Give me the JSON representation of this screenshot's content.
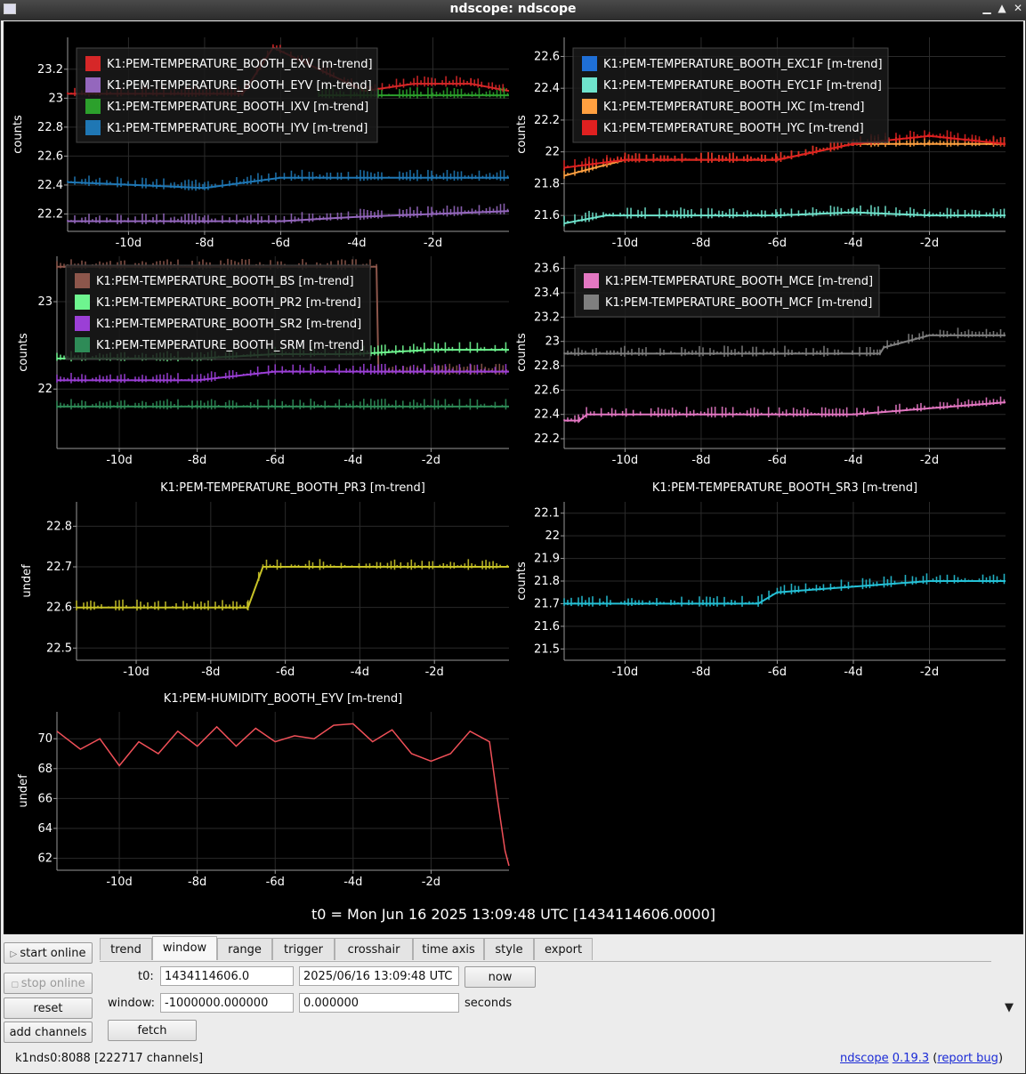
{
  "window": {
    "title": "ndscope: ndscope",
    "minimize": "▁",
    "maximize": "▲",
    "close": "✕"
  },
  "t0_label": "t0 = Mon Jun 16 2025 13:09:48 UTC [1434114606.0000]",
  "plots": [
    {
      "id": "p1",
      "title": "",
      "ylabel": "counts",
      "yticks": [
        "23.2",
        "23",
        "22.8",
        "22.6",
        "22.4",
        "22.2"
      ],
      "xticks": [
        "-10d",
        "-8d",
        "-6d",
        "-4d",
        "-2d"
      ],
      "legend": [
        {
          "name": "K1:PEM-TEMPERATURE_BOOTH_EXV [m-trend]",
          "color": "#d62728"
        },
        {
          "name": "K1:PEM-TEMPERATURE_BOOTH_EYV [m-trend]",
          "color": "#9467bd"
        },
        {
          "name": "K1:PEM-TEMPERATURE_BOOTH_IXV [m-trend]",
          "color": "#2ca02c"
        },
        {
          "name": "K1:PEM-TEMPERATURE_BOOTH_IYV [m-trend]",
          "color": "#1f77b4"
        }
      ]
    },
    {
      "id": "p2",
      "title": "",
      "ylabel": "counts",
      "yticks": [
        "22.6",
        "22.4",
        "22.2",
        "22",
        "21.8",
        "21.6"
      ],
      "xticks": [
        "-10d",
        "-8d",
        "-6d",
        "-4d",
        "-2d"
      ],
      "legend": [
        {
          "name": "K1:PEM-TEMPERATURE_BOOTH_EXC1F [m-trend]",
          "color": "#1f6fd6"
        },
        {
          "name": "K1:PEM-TEMPERATURE_BOOTH_EYC1F [m-trend]",
          "color": "#6fe3cc"
        },
        {
          "name": "K1:PEM-TEMPERATURE_BOOTH_IXC [m-trend]",
          "color": "#ffa040"
        },
        {
          "name": "K1:PEM-TEMPERATURE_BOOTH_IYC [m-trend]",
          "color": "#e02020"
        }
      ]
    },
    {
      "id": "p3",
      "title": "",
      "ylabel": "counts",
      "yticks": [
        "23",
        "22"
      ],
      "xticks": [
        "-10d",
        "-8d",
        "-6d",
        "-4d",
        "-2d"
      ],
      "legend": [
        {
          "name": "K1:PEM-TEMPERATURE_BOOTH_BS [m-trend]",
          "color": "#8c564b"
        },
        {
          "name": "K1:PEM-TEMPERATURE_BOOTH_PR2 [m-trend]",
          "color": "#6ef58f"
        },
        {
          "name": "K1:PEM-TEMPERATURE_BOOTH_SR2 [m-trend]",
          "color": "#9b3fd6"
        },
        {
          "name": "K1:PEM-TEMPERATURE_BOOTH_SRM [m-trend]",
          "color": "#2e8b57"
        }
      ]
    },
    {
      "id": "p4",
      "title": "",
      "ylabel": "counts",
      "yticks": [
        "23.6",
        "23.4",
        "23.2",
        "23",
        "22.8",
        "22.6",
        "22.4",
        "22.2"
      ],
      "xticks": [
        "-10d",
        "-8d",
        "-6d",
        "-4d",
        "-2d"
      ],
      "legend": [
        {
          "name": "K1:PEM-TEMPERATURE_BOOTH_MCE [m-trend]",
          "color": "#e377c2"
        },
        {
          "name": "K1:PEM-TEMPERATURE_BOOTH_MCF [m-trend]",
          "color": "#7f7f7f"
        }
      ]
    },
    {
      "id": "p5",
      "title": "K1:PEM-TEMPERATURE_BOOTH_PR3 [m-trend]",
      "ylabel": "undef",
      "yticks": [
        "22.8",
        "22.7",
        "22.6",
        "22.5"
      ],
      "xticks": [
        "-10d",
        "-8d",
        "-6d",
        "-4d",
        "-2d"
      ],
      "legend": []
    },
    {
      "id": "p6",
      "title": "K1:PEM-TEMPERATURE_BOOTH_SR3 [m-trend]",
      "ylabel": "counts",
      "yticks": [
        "22.1",
        "22",
        "21.9",
        "21.8",
        "21.7",
        "21.6",
        "21.5"
      ],
      "xticks": [
        "-10d",
        "-8d",
        "-6d",
        "-4d",
        "-2d"
      ],
      "legend": []
    },
    {
      "id": "p7",
      "title": "K1:PEM-HUMIDITY_BOOTH_EYV [m-trend]",
      "ylabel": "undef",
      "yticks": [
        "70",
        "68",
        "66",
        "64",
        "62"
      ],
      "xticks": [
        "-10d",
        "-8d",
        "-6d",
        "-4d",
        "-2d"
      ],
      "legend": []
    }
  ],
  "chart_data": [
    {
      "type": "line",
      "xlabel": "",
      "ylabel": "counts",
      "xlim": [
        -11.6,
        0
      ],
      "ylim": [
        22.08,
        23.42
      ],
      "series": [
        {
          "name": "K1:PEM-TEMPERATURE_BOOTH_EXV [m-trend]",
          "color": "#d62728",
          "x": [
            -11.6,
            -7,
            -6.2,
            -3.8,
            -2.5,
            -1,
            0
          ],
          "y": [
            23.03,
            23.03,
            23.35,
            23.05,
            23.1,
            23.1,
            23.05
          ]
        },
        {
          "name": "K1:PEM-TEMPERATURE_BOOTH_EYV [m-trend]",
          "color": "#9467bd",
          "x": [
            -11.6,
            -8,
            -6,
            -4,
            -2,
            0
          ],
          "y": [
            22.15,
            22.15,
            22.15,
            22.18,
            22.2,
            22.22
          ]
        },
        {
          "name": "K1:PEM-TEMPERATURE_BOOTH_IXV [m-trend]",
          "color": "#2ca02c",
          "x": [
            -5,
            -4,
            -2,
            0
          ],
          "y": [
            23.02,
            23.02,
            23.02,
            23.02
          ]
        },
        {
          "name": "K1:PEM-TEMPERATURE_BOOTH_IYV [m-trend]",
          "color": "#1f77b4",
          "x": [
            -11.6,
            -8,
            -6,
            -4,
            -2,
            0
          ],
          "y": [
            22.42,
            22.38,
            22.45,
            22.45,
            22.45,
            22.45
          ]
        }
      ]
    },
    {
      "type": "line",
      "xlabel": "",
      "ylabel": "counts",
      "xlim": [
        -11.6,
        0
      ],
      "ylim": [
        21.5,
        22.72
      ],
      "series": [
        {
          "name": "K1:PEM-TEMPERATURE_BOOTH_EXC1F [m-trend]",
          "color": "#1f6fd6",
          "x": [],
          "y": []
        },
        {
          "name": "K1:PEM-TEMPERATURE_BOOTH_EYC1F [m-trend]",
          "color": "#6fe3cc",
          "x": [
            -11.6,
            -10.5,
            -8,
            -6,
            -4,
            -2,
            0
          ],
          "y": [
            21.55,
            21.6,
            21.6,
            21.6,
            21.62,
            21.6,
            21.6
          ]
        },
        {
          "name": "K1:PEM-TEMPERATURE_BOOTH_IXC [m-trend]",
          "color": "#ffa040",
          "x": [
            -11.6,
            -10,
            -8,
            -6,
            -4,
            -2,
            0
          ],
          "y": [
            21.85,
            21.95,
            21.95,
            21.95,
            22.05,
            22.05,
            22.05
          ]
        },
        {
          "name": "K1:PEM-TEMPERATURE_BOOTH_IYC [m-trend]",
          "color": "#e02020",
          "x": [
            -11.6,
            -10,
            -8,
            -6,
            -4,
            -2,
            0
          ],
          "y": [
            21.9,
            21.95,
            21.95,
            21.95,
            22.05,
            22.1,
            22.05
          ]
        }
      ]
    },
    {
      "type": "line",
      "xlabel": "",
      "ylabel": "counts",
      "xlim": [
        -11.6,
        0
      ],
      "ylim": [
        21.32,
        23.52
      ],
      "series": [
        {
          "name": "K1:PEM-TEMPERATURE_BOOTH_BS [m-trend]",
          "color": "#8c564b",
          "x": [
            -11.6,
            -3.4,
            -3.35,
            0
          ],
          "y": [
            23.4,
            23.4,
            22.2,
            22.2
          ]
        },
        {
          "name": "K1:PEM-TEMPERATURE_BOOTH_PR2 [m-trend]",
          "color": "#6ef58f",
          "x": [
            -11.6,
            -8,
            -6,
            -4,
            -2,
            0
          ],
          "y": [
            22.35,
            22.35,
            22.4,
            22.4,
            22.45,
            22.45
          ]
        },
        {
          "name": "K1:PEM-TEMPERATURE_BOOTH_SR2 [m-trend]",
          "color": "#9b3fd6",
          "x": [
            -11.6,
            -8,
            -6,
            -4,
            -2,
            0
          ],
          "y": [
            22.1,
            22.1,
            22.2,
            22.2,
            22.2,
            22.2
          ]
        },
        {
          "name": "K1:PEM-TEMPERATURE_BOOTH_SRM [m-trend]",
          "color": "#2e8b57",
          "x": [
            -11.6,
            -8,
            -6,
            -4,
            -2,
            0
          ],
          "y": [
            21.8,
            21.8,
            21.8,
            21.8,
            21.8,
            21.8
          ]
        }
      ]
    },
    {
      "type": "line",
      "xlabel": "",
      "ylabel": "counts",
      "xlim": [
        -11.6,
        0
      ],
      "ylim": [
        22.12,
        23.7
      ],
      "series": [
        {
          "name": "K1:PEM-TEMPERATURE_BOOTH_MCE [m-trend]",
          "color": "#e377c2",
          "x": [
            -11.6,
            -11.2,
            -11,
            -4,
            -2,
            0
          ],
          "y": [
            22.35,
            22.35,
            22.4,
            22.4,
            22.45,
            22.5
          ]
        },
        {
          "name": "K1:PEM-TEMPERATURE_BOOTH_MCF [m-trend]",
          "color": "#7f7f7f",
          "x": [
            -11.6,
            -3.3,
            -3.2,
            -2,
            0
          ],
          "y": [
            22.9,
            22.9,
            22.95,
            23.05,
            23.05
          ]
        }
      ]
    },
    {
      "type": "line",
      "title": "K1:PEM-TEMPERATURE_BOOTH_PR3 [m-trend]",
      "ylabel": "undef",
      "xlim": [
        -11.6,
        0
      ],
      "ylim": [
        22.47,
        22.86
      ],
      "series": [
        {
          "name": "",
          "color": "#c8c327",
          "x": [
            -11.6,
            -7,
            -6.6,
            -3,
            -1,
            0
          ],
          "y": [
            22.6,
            22.6,
            22.7,
            22.7,
            22.7,
            22.7
          ]
        }
      ]
    },
    {
      "type": "line",
      "title": "K1:PEM-TEMPERATURE_BOOTH_SR3 [m-trend]",
      "ylabel": "counts",
      "xlim": [
        -11.6,
        0
      ],
      "ylim": [
        21.45,
        22.15
      ],
      "series": [
        {
          "name": "",
          "color": "#25c1d6",
          "x": [
            -11.6,
            -6.5,
            -6,
            -2,
            0
          ],
          "y": [
            21.7,
            21.7,
            21.75,
            21.8,
            21.8
          ]
        }
      ]
    },
    {
      "type": "line",
      "title": "K1:PEM-HUMIDITY_BOOTH_EYV [m-trend]",
      "ylabel": "undef",
      "xlim": [
        -11.6,
        0
      ],
      "ylim": [
        61.2,
        71.8
      ],
      "series": [
        {
          "name": "",
          "color": "#f05058",
          "x": [
            -11.6,
            -11,
            -10.5,
            -10,
            -9.5,
            -9,
            -8.5,
            -8,
            -7.5,
            -7,
            -6.5,
            -6,
            -5.5,
            -5,
            -4.5,
            -4,
            -3.5,
            -3,
            -2.5,
            -2,
            -1.5,
            -1,
            -0.5,
            -0.3,
            -0.1,
            0
          ],
          "y": [
            70.5,
            69.3,
            70,
            68.2,
            69.8,
            69,
            70.5,
            69.5,
            70.8,
            69.5,
            70.7,
            69.8,
            70.2,
            70,
            70.9,
            71,
            69.8,
            70.6,
            69,
            68.5,
            69,
            70.5,
            69.8,
            66,
            62.5,
            61.5
          ]
        }
      ]
    }
  ],
  "controls": {
    "start_online": "start online",
    "stop_online": "stop online",
    "reset": "reset",
    "add_channels": "add channels",
    "tabs": [
      "trend",
      "window",
      "range",
      "trigger",
      "crosshair",
      "time axis",
      "style",
      "export"
    ],
    "active_tab": "window",
    "t0_label": "t0:",
    "t0_gps": "1434114606.0",
    "t0_utc": "2025/06/16 13:09:48 UTC",
    "now_label": "now",
    "window_label": "window:",
    "window_start": "-1000000.000000",
    "window_end": "0.000000",
    "seconds_label": "seconds",
    "fetch_label": "fetch"
  },
  "status": {
    "server": "k1nds0:8088",
    "channels": "[222717 channels]",
    "app_name": "ndscope",
    "version": "0.19.3",
    "report": "report bug"
  }
}
